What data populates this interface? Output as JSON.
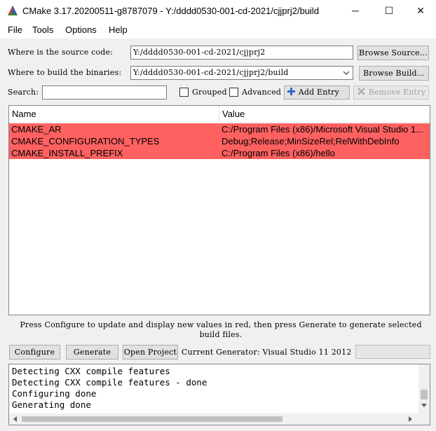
{
  "window": {
    "title": "CMake 3.17.20200511-g8787079 - Y:/dddd0530-001-cd-2021/cjjprj2/build",
    "minimize_glyph": "─",
    "maximize_glyph": "☐",
    "close_glyph": "✕"
  },
  "menu": [
    "File",
    "Tools",
    "Options",
    "Help"
  ],
  "source": {
    "label": "Where is the source code:",
    "value": "Y:/dddd0530-001-cd-2021/cjjprj2",
    "browse_label": "Browse Source..."
  },
  "build": {
    "label": "Where to build the binaries:",
    "value": "Y:/dddd0530-001-cd-2021/cjjprj2/build",
    "browse_label": "Browse Build..."
  },
  "search": {
    "label": "Search:",
    "value": "",
    "grouped_label": "Grouped",
    "advanced_label": "Advanced",
    "add_entry_label": "Add Entry",
    "remove_entry_label": "Remove Entry"
  },
  "table": {
    "columns": [
      "Name",
      "Value"
    ],
    "rows": [
      {
        "name": "CMAKE_AR",
        "value": "C:/Program Files (x86)/Microsoft Visual Studio 1..."
      },
      {
        "name": "CMAKE_CONFIGURATION_TYPES",
        "value": "Debug;Release;MinSizeRel;RelWithDebInfo"
      },
      {
        "name": "CMAKE_INSTALL_PREFIX",
        "value": "C:/Program Files (x86)/hello"
      }
    ],
    "highlight_color": "#ff6161"
  },
  "hint": {
    "line1": "Press Configure to update and display new values in red, then press Generate to generate selected",
    "line2": "build files."
  },
  "actions": {
    "configure_label": "Configure",
    "generate_label": "Generate",
    "open_project_label": "Open Project",
    "generator_text": "Current Generator: Visual Studio 11 2012"
  },
  "log": {
    "lines": [
      "Detecting CXX compile features",
      "Detecting CXX compile features - done",
      "Configuring done",
      "Generating done"
    ]
  },
  "icons": {
    "app": "cmake-triangle-icon",
    "add": "plus-icon",
    "remove": "x-icon"
  }
}
